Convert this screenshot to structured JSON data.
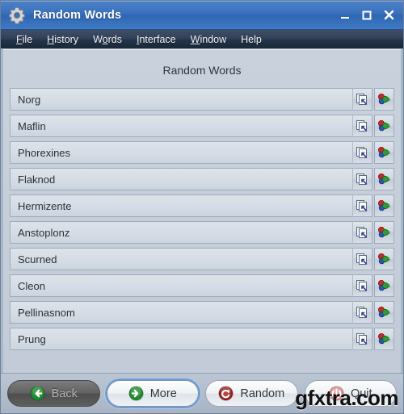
{
  "window": {
    "title": "Random Words",
    "app_icon": "gear-icon",
    "controls": {
      "minimize": "minimize-icon",
      "maximize": "maximize-icon",
      "close": "close-icon"
    }
  },
  "menubar": {
    "items": [
      {
        "label": "File",
        "mnemonic_index": 0
      },
      {
        "label": "History",
        "mnemonic_index": 0
      },
      {
        "label": "Words",
        "mnemonic_index": 1
      },
      {
        "label": "Interface",
        "mnemonic_index": 0
      },
      {
        "label": "Window",
        "mnemonic_index": 0
      },
      {
        "label": "Help",
        "mnemonic_index": -1
      }
    ]
  },
  "main": {
    "heading": "Random Words",
    "row_actions": {
      "copy_label": "copy-icon",
      "variants_label": "variants-icon"
    },
    "words": [
      {
        "text": "Norg"
      },
      {
        "text": "Maflin"
      },
      {
        "text": "Phorexines"
      },
      {
        "text": "Flaknod"
      },
      {
        "text": "Hermizente"
      },
      {
        "text": "Anstoplonz"
      },
      {
        "text": "Scurned"
      },
      {
        "text": "Cleon"
      },
      {
        "text": "Pellinasnom"
      },
      {
        "text": "Prung"
      }
    ]
  },
  "bottombar": {
    "buttons": [
      {
        "label": "Back",
        "icon": "arrow-left-circle-icon",
        "state": "disabled",
        "icon_color": "#1f8a2e"
      },
      {
        "label": "More",
        "icon": "arrow-right-circle-icon",
        "state": "focused",
        "icon_color": "#1f8a2e"
      },
      {
        "label": "Random",
        "icon": "refresh-circle-icon",
        "state": "normal",
        "icon_color": "#9e2020"
      },
      {
        "label": "Quit",
        "icon": "power-circle-icon",
        "state": "normal",
        "icon_color": "#d98d8d"
      }
    ]
  },
  "watermark": {
    "text": "gfxtra.com"
  },
  "colors": {
    "title_bar_blue": "#3b72bd",
    "menu_bar_dark": "#243449",
    "client_bg": "#c5ced9",
    "field_bg": "#d7dee6",
    "accent_green": "#1f8a2e",
    "accent_red": "#9e2020",
    "focus_ring": "#6f9ed6"
  }
}
